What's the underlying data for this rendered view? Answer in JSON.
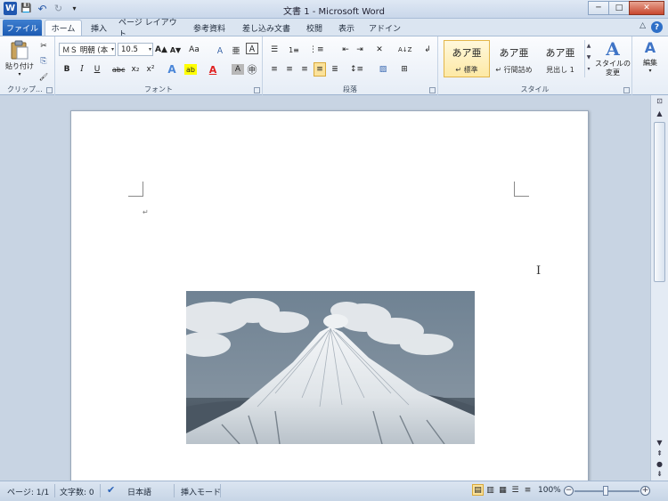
{
  "window": {
    "title": "文書 1 - Microsoft Word",
    "min_label": "─",
    "max_label": "□",
    "close_label": "✕"
  },
  "qat": {
    "word_icon": "W",
    "save_icon": "💾",
    "undo_icon": "↶",
    "redo_icon": "↻",
    "customize_icon": "▾"
  },
  "tabs": [
    {
      "label": "ファイル"
    },
    {
      "label": "ホーム"
    },
    {
      "label": "挿入"
    },
    {
      "label": "ページ レイアウト"
    },
    {
      "label": "参考資料"
    },
    {
      "label": "差し込み文書"
    },
    {
      "label": "校閲"
    },
    {
      "label": "表示"
    },
    {
      "label": "アドイン"
    }
  ],
  "ribbon": {
    "clipboard": {
      "label": "クリップ...",
      "paste": "貼り付け",
      "cut": "✂",
      "copy": "⎘",
      "format_painter": "🖌"
    },
    "font": {
      "label": "フォント",
      "font_name": "ＭＳ 明朝 (本",
      "font_size": "10.5",
      "grow": "A▲",
      "shrink": "A▼",
      "case": "Aa",
      "clear": "Ａ",
      "phonetic": "亜",
      "enclose": "Ａ",
      "bold": "B",
      "italic": "I",
      "underline": "U",
      "strike": "abc",
      "subscript": "x₂",
      "superscript": "x²",
      "effect": "A",
      "highlight": "ab",
      "font_color": "A",
      "shade": "A",
      "enclose_char": "㊥"
    },
    "paragraph": {
      "label": "段落",
      "bullets": "☰",
      "numbering": "1≡",
      "multilevel": "⋮≡",
      "decrease_indent": "⇤",
      "increase_indent": "⇥",
      "sort": "A↓Z",
      "show_marks": "↲",
      "align_left": "≡",
      "align_center": "≡",
      "align_right": "≡",
      "justify": "≡",
      "distribute": "≣",
      "line_spacing": "↕≡",
      "shading": "▨",
      "borders": "⊞",
      "asian_layout": "✕"
    },
    "styles": {
      "label": "スタイル",
      "items": [
        {
          "sample": "あア亜",
          "name": "↵ 標準"
        },
        {
          "sample": "あア亜",
          "name": "↵ 行間詰め"
        },
        {
          "sample": "あア亜",
          "name": "見出し 1"
        }
      ],
      "change_styles": "スタイルの\n変更",
      "change_icon": "A"
    },
    "editing": {
      "label": "編集",
      "icon": "A"
    }
  },
  "document": {
    "paragraph_mark": "↵",
    "cursor": "I"
  },
  "status": {
    "page": "ページ: 1/1",
    "words": "文字数: 0",
    "language": "日本語",
    "mode": "挿入モード",
    "zoom": "100%",
    "zoom_minus": "−",
    "zoom_plus": "+"
  },
  "colors": {
    "accent": "#1f57b0",
    "highlight": "#ffff00",
    "font_color": "#e02020"
  }
}
